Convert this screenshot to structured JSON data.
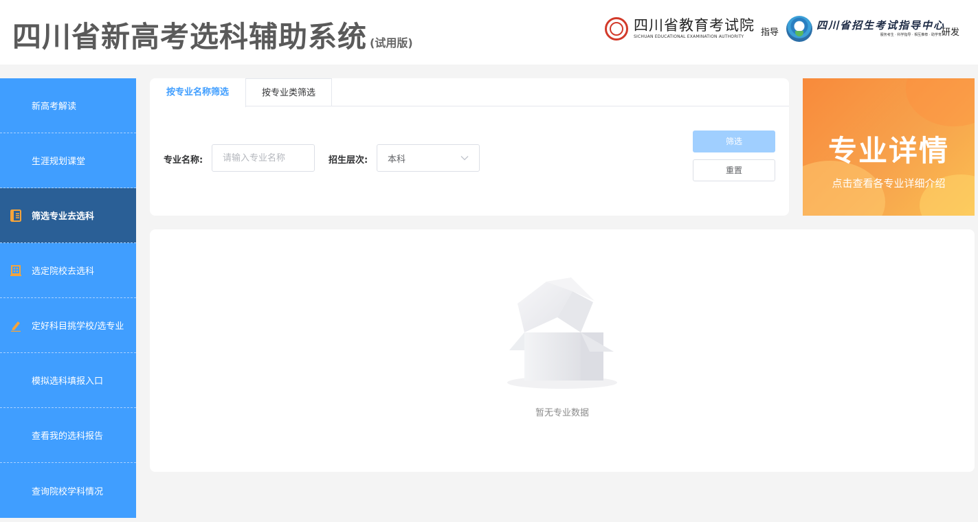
{
  "header": {
    "title": "四川省新高考选科辅助系统",
    "subtitle": "(试用版)",
    "org1": {
      "name": "四川省教育考试院",
      "name_en": "SICHUAN EDUCATIONAL EXAMINATION AUTHORITY",
      "verb": "指导",
      "logo_icon": "sceea-seal-icon",
      "logo_color": "#d23a2a"
    },
    "org2": {
      "name": "四川省招生考试指导中心",
      "slogan": "服务考生 · 科学指导 · 相互推荐 · 助学育人",
      "verb": "研发",
      "logo_icon": "guidance-center-emblem-icon"
    }
  },
  "sidebar": {
    "items": [
      {
        "label": "新高考解读",
        "icon": null,
        "active": false
      },
      {
        "label": "生涯规划课堂",
        "icon": null,
        "active": false
      },
      {
        "label": "筛选专业去选科",
        "icon": "book-icon",
        "active": true
      },
      {
        "label": "选定院校去选科",
        "icon": "building-icon",
        "active": false
      },
      {
        "label": "定好科目挑学校/选专业",
        "icon": "pencil-icon",
        "active": false
      },
      {
        "label": "模拟选科填报入口",
        "icon": null,
        "active": false
      },
      {
        "label": "查看我的选科报告",
        "icon": null,
        "active": false
      },
      {
        "label": "查询院校学科情况",
        "icon": null,
        "active": false
      }
    ]
  },
  "filter": {
    "tabs": [
      {
        "label": "按专业名称筛选",
        "active": true
      },
      {
        "label": "按专业类筛选",
        "active": false
      }
    ],
    "major_name_label": "专业名称:",
    "major_name_placeholder": "请输入专业名称",
    "major_name_value": "",
    "level_label": "招生层次:",
    "level_value": "本科",
    "filter_button": "筛选",
    "reset_button": "重置"
  },
  "banner": {
    "title": "专业详情",
    "subtitle": "点击查看各专业详细介绍"
  },
  "results": {
    "empty_text": "暂无专业数据",
    "empty_icon": "empty-box-icon"
  },
  "colors": {
    "sidebar_bg": "#409eff",
    "sidebar_active_bg": "#2a5f96",
    "accent": "#409eff",
    "icon_orange": "#f5a43b",
    "banner_orange": "#f88a3b"
  }
}
